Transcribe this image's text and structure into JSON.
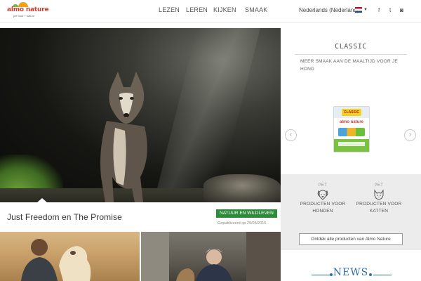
{
  "header": {
    "logo": {
      "brand": "almo nature",
      "tagline": "pet food + nature"
    },
    "nav": [
      {
        "label": "LEZEN"
      },
      {
        "label": "LEREN"
      },
      {
        "label": "KIJKEN"
      },
      {
        "label": "SMAAK"
      }
    ],
    "language": {
      "label": "Nederlands (Nederland)",
      "flag": "netherlands-flag-icon"
    },
    "social": [
      {
        "icon": "facebook-icon",
        "glyph": "f"
      },
      {
        "icon": "twitter-icon",
        "glyph": "t"
      },
      {
        "icon": "instagram-icon",
        "glyph": "◙"
      }
    ]
  },
  "hero": {
    "image": "wolf-in-cave-photo",
    "title": "Just Freedom en The Promise",
    "badge": "NATUUR EN WILDLEVEN",
    "date": "Gepubliceerd op 29/05/2015"
  },
  "thumbs": [
    {
      "image": "man-with-golden-retriever-photo"
    },
    {
      "image": "man-with-dog-indoors-photo"
    }
  ],
  "sidebar": {
    "product_title": "CLASSIC",
    "product_subtitle": "MEER SMAAK AAN DE MAALTIJD VOOR JE HOND",
    "package": {
      "label": "CLASSIC",
      "brand": "almo nature"
    },
    "prev": "‹",
    "next": "›",
    "pets": [
      {
        "pre": "PET",
        "name": "PRODUCTEN VOOR HONDEN",
        "icon": "dog-icon"
      },
      {
        "pre": "PET",
        "name": "PRODUCTEN VOOR KATTEN",
        "icon": "cat-icon"
      }
    ],
    "all_products": "Ontdek alle producten van Almo Nature",
    "news": "NEWS"
  },
  "colors": {
    "badge_green": "#2e8b3a",
    "brand_red": "#d33a2c",
    "news_blue": "#2f6fa8"
  }
}
